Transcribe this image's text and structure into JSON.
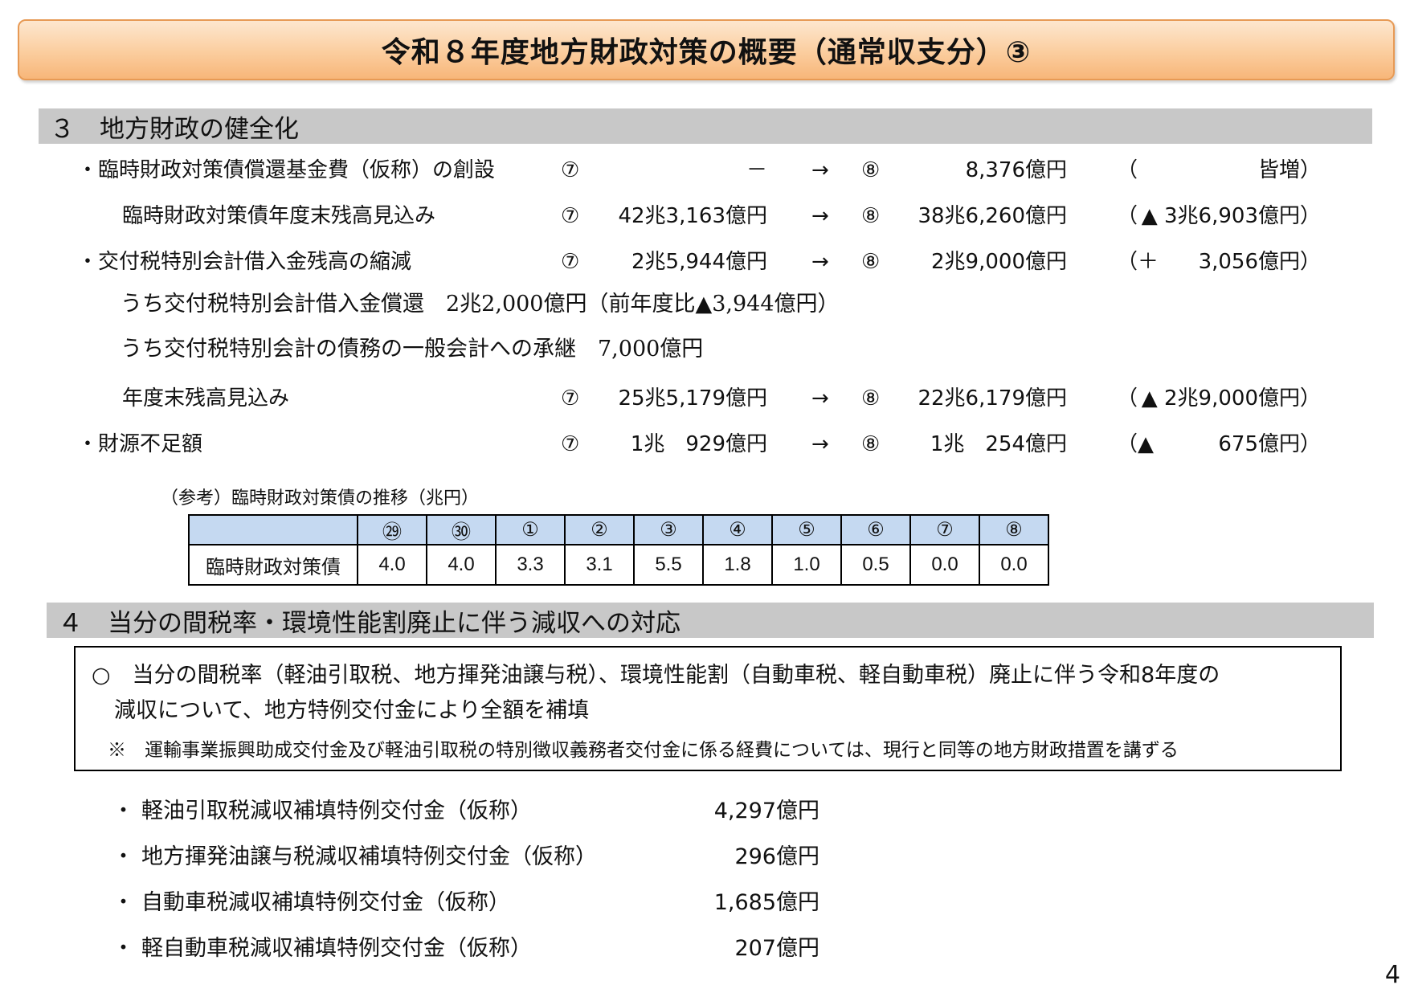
{
  "title": "令和８年度地方財政対策の概要（通常収支分）③",
  "section3": {
    "heading": "３　地方財政の健全化",
    "rows": [
      {
        "bullet": "・",
        "label": "臨時財政対策債償還基金費（仮称）の創設",
        "m1": "⑦",
        "v1": "－",
        "arrow": "→",
        "m2": "⑧",
        "v2": "8,376億円",
        "open": "（",
        "diff": "皆増）"
      },
      {
        "bullet": "",
        "label": "臨時財政対策債年度末残高見込み",
        "m1": "⑦",
        "v1": "42兆3,163億円",
        "arrow": "→",
        "m2": "⑧",
        "v2": "38兆6,260億円",
        "open": "（",
        "diff": "▲ 3兆6,903億円）"
      },
      {
        "bullet": "・",
        "label": "交付税特別会計借入金残高の縮減",
        "m1": "⑦",
        "v1": "2兆5,944億円",
        "arrow": "→",
        "m2": "⑧",
        "v2": "2兆9,000億円",
        "open": "（＋",
        "diff": "3,056億円）"
      },
      {
        "bullet": "",
        "label": "年度末残高見込み",
        "m1": "⑦",
        "v1": "25兆5,179億円",
        "arrow": "→",
        "m2": "⑧",
        "v2": "22兆6,179億円",
        "open": "（",
        "diff": "▲ 2兆9,000億円）"
      },
      {
        "bullet": "・",
        "label": "財源不足額",
        "m1": "⑦",
        "v1": "1兆　929億円",
        "arrow": "→",
        "m2": "⑧",
        "v2": "1兆　254億円",
        "open": "（▲",
        "diff": "675億円）"
      }
    ],
    "sub_lines": [
      "うち交付税特別会計借入金償還　2兆2,000億円（前年度比▲3,944億円）",
      "うち交付税特別会計の債務の一般会計への承継　7,000億円"
    ],
    "reference": {
      "caption": "（参考）臨時財政対策債の推移（兆円）",
      "row_label": "臨時財政対策債",
      "years": [
        "㉙",
        "㉚",
        "①",
        "②",
        "③",
        "④",
        "⑤",
        "⑥",
        "⑦",
        "⑧"
      ],
      "values": [
        "4.0",
        "4.0",
        "3.3",
        "3.1",
        "5.5",
        "1.8",
        "1.0",
        "0.5",
        "0.0",
        "0.0"
      ]
    }
  },
  "section4": {
    "heading": "４　当分の間税率・環境性能割廃止に伴う減収への対応",
    "box_line1": "○　当分の間税率（軽油引取税、地方揮発油譲与税）、環境性能割（自動車税、軽自動車税）廃止に伴う令和8年度の",
    "box_line2": "減収について、地方特例交付金により全額を補填",
    "box_note": "※　運輸事業振興助成交付金及び軽油引取税の特別徴収義務者交付金に係る経費については、現行と同等の地方財政措置を講ずる",
    "items": [
      {
        "bullet": "・",
        "name": "軽油引取税減収補填特例交付金（仮称）",
        "value": "4,297億円"
      },
      {
        "bullet": "・",
        "name": "地方揮発油譲与税減収補填特例交付金（仮称）",
        "value": "296億円"
      },
      {
        "bullet": "・",
        "name": "自動車税減収補填特例交付金（仮称）",
        "value": "1,685億円"
      },
      {
        "bullet": "・",
        "name": "軽自動車税減収補填特例交付金（仮称）",
        "value": "207億円"
      }
    ]
  },
  "page_number": "4"
}
